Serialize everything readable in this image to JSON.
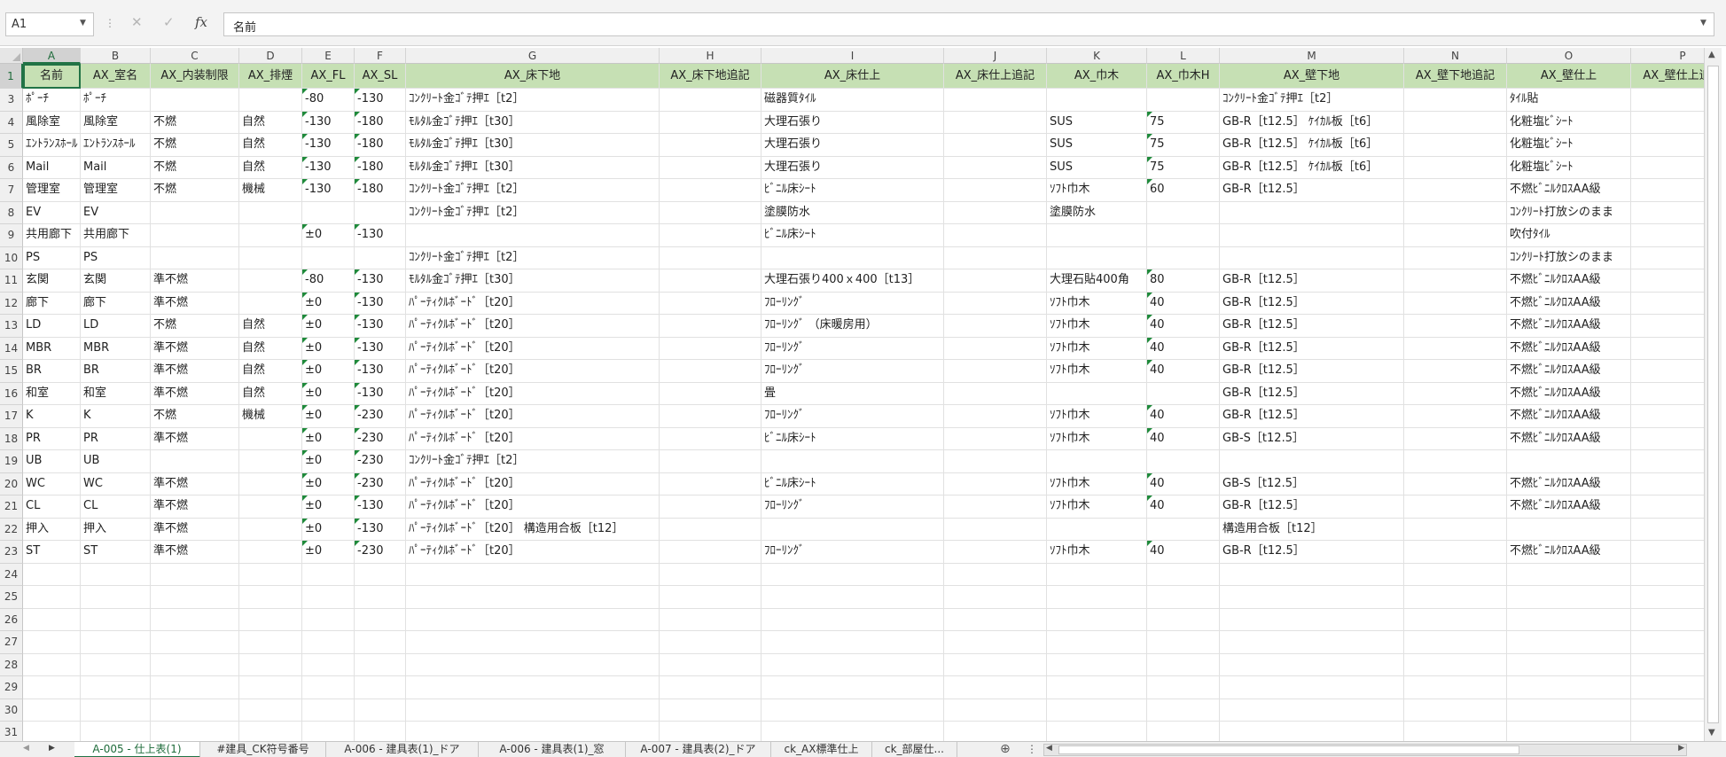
{
  "formula_bar": {
    "name_box": "A1",
    "formula": "名前",
    "fx_label": "fx",
    "cancel_glyph": "✕",
    "enter_glyph": "✓"
  },
  "columns": [
    "A",
    "B",
    "C",
    "D",
    "E",
    "F",
    "G",
    "H",
    "I",
    "J",
    "K",
    "L",
    "M",
    "N",
    "O",
    "P"
  ],
  "selected_column": "A",
  "selected_row": "1",
  "headers": [
    "名前",
    "AX_室名",
    "AX_内装制限",
    "AX_排煙",
    "AX_FL",
    "AX_SL",
    "AX_床下地",
    "AX_床下地追記",
    "AX_床仕上",
    "AX_床仕上追記",
    "AX_巾木",
    "AX_巾木H",
    "AX_壁下地",
    "AX_壁下地追記",
    "AX_壁仕上",
    "AX_壁仕上追記"
  ],
  "rows": [
    {
      "num": "1",
      "header": true
    },
    {
      "num": "3",
      "cells": [
        "ﾎﾟｰﾁ",
        "ﾎﾟｰﾁ",
        "",
        "",
        "-80",
        "-130",
        "ｺﾝｸﾘｰﾄ金ｺﾞﾃ押ｴ［t2］",
        "",
        "磁器質ﾀｲﾙ",
        "",
        "",
        "",
        "ｺﾝｸﾘｰﾄ金ｺﾞﾃ押ｴ［t2］",
        "",
        "ﾀｲﾙ貼",
        ""
      ]
    },
    {
      "num": "4",
      "cells": [
        "風除室",
        "風除室",
        "不燃",
        "自然",
        "-130",
        "-180",
        "ﾓﾙﾀﾙ金ｺﾞﾃ押ｴ［t30］",
        "",
        "大理石張り",
        "",
        "SUS",
        "75",
        "GB-R［t12.5］ ｹｲｶﾙ板［t6］",
        "",
        "化粧塩ﾋﾞｼｰﾄ",
        ""
      ]
    },
    {
      "num": "5",
      "cells": [
        "ｴﾝﾄﾗﾝｽﾎｰﾙ",
        "ｴﾝﾄﾗﾝｽﾎｰﾙ",
        "不燃",
        "自然",
        "-130",
        "-180",
        "ﾓﾙﾀﾙ金ｺﾞﾃ押ｴ［t30］",
        "",
        "大理石張り",
        "",
        "SUS",
        "75",
        "GB-R［t12.5］ ｹｲｶﾙ板［t6］",
        "",
        "化粧塩ﾋﾞｼｰﾄ",
        ""
      ]
    },
    {
      "num": "6",
      "cells": [
        "Mail",
        "Mail",
        "不燃",
        "自然",
        "-130",
        "-180",
        "ﾓﾙﾀﾙ金ｺﾞﾃ押ｴ［t30］",
        "",
        "大理石張り",
        "",
        "SUS",
        "75",
        "GB-R［t12.5］ ｹｲｶﾙ板［t6］",
        "",
        "化粧塩ﾋﾞｼｰﾄ",
        ""
      ]
    },
    {
      "num": "7",
      "cells": [
        "管理室",
        "管理室",
        "不燃",
        "機械",
        "-130",
        "-180",
        "ｺﾝｸﾘｰﾄ金ｺﾞﾃ押ｴ［t2］",
        "",
        "ﾋﾞﾆﾙ床ｼｰﾄ",
        "",
        "ｿﾌﾄ巾木",
        "60",
        "GB-R［t12.5］",
        "",
        "不燃ﾋﾞﾆﾙｸﾛｽAA級",
        ""
      ]
    },
    {
      "num": "8",
      "cells": [
        "EV",
        "EV",
        "",
        "",
        "",
        "",
        "ｺﾝｸﾘｰﾄ金ｺﾞﾃ押ｴ［t2］",
        "",
        "塗膜防水",
        "",
        "塗膜防水",
        "",
        "",
        "",
        "ｺﾝｸﾘｰﾄ打放シのまま",
        ""
      ]
    },
    {
      "num": "9",
      "cells": [
        "共用廊下",
        "共用廊下",
        "",
        "",
        "±0",
        "-130",
        "",
        "",
        "ﾋﾞﾆﾙ床ｼｰﾄ",
        "",
        "",
        "",
        "",
        "",
        "吹付ﾀｲﾙ",
        ""
      ]
    },
    {
      "num": "10",
      "cells": [
        "PS",
        "PS",
        "",
        "",
        "",
        "",
        "ｺﾝｸﾘｰﾄ金ｺﾞﾃ押ｴ［t2］",
        "",
        "",
        "",
        "",
        "",
        "",
        "",
        "ｺﾝｸﾘｰﾄ打放シのまま",
        ""
      ]
    },
    {
      "num": "11",
      "cells": [
        "玄関",
        "玄関",
        "準不燃",
        "",
        "-80",
        "-130",
        "ﾓﾙﾀﾙ金ｺﾞﾃ押ｴ［t30］",
        "",
        "大理石張り400ｘ400［t13］",
        "",
        "大理石貼400角",
        "80",
        "GB-R［t12.5］",
        "",
        "不燃ﾋﾞﾆﾙｸﾛｽAA級",
        ""
      ]
    },
    {
      "num": "12",
      "cells": [
        "廊下",
        "廊下",
        "準不燃",
        "",
        "±0",
        "-130",
        "ﾊﾟｰﾃｨｸﾙﾎﾞｰﾄﾞ［t20］",
        "",
        "ﾌﾛｰﾘﾝｸﾞ",
        "",
        "ｿﾌﾄ巾木",
        "40",
        "GB-R［t12.5］",
        "",
        "不燃ﾋﾞﾆﾙｸﾛｽAA級",
        ""
      ]
    },
    {
      "num": "13",
      "cells": [
        "LD",
        "LD",
        "不燃",
        "自然",
        "±0",
        "-130",
        "ﾊﾟｰﾃｨｸﾙﾎﾞｰﾄﾞ［t20］",
        "",
        "ﾌﾛｰﾘﾝｸﾞ （床暖房用）",
        "",
        "ｿﾌﾄ巾木",
        "40",
        "GB-R［t12.5］",
        "",
        "不燃ﾋﾞﾆﾙｸﾛｽAA級",
        ""
      ]
    },
    {
      "num": "14",
      "cells": [
        "MBR",
        "MBR",
        "準不燃",
        "自然",
        "±0",
        "-130",
        "ﾊﾟｰﾃｨｸﾙﾎﾞｰﾄﾞ［t20］",
        "",
        "ﾌﾛｰﾘﾝｸﾞ",
        "",
        "ｿﾌﾄ巾木",
        "40",
        "GB-R［t12.5］",
        "",
        "不燃ﾋﾞﾆﾙｸﾛｽAA級",
        ""
      ]
    },
    {
      "num": "15",
      "cells": [
        "BR",
        "BR",
        "準不燃",
        "自然",
        "±0",
        "-130",
        "ﾊﾟｰﾃｨｸﾙﾎﾞｰﾄﾞ［t20］",
        "",
        "ﾌﾛｰﾘﾝｸﾞ",
        "",
        "ｿﾌﾄ巾木",
        "40",
        "GB-R［t12.5］",
        "",
        "不燃ﾋﾞﾆﾙｸﾛｽAA級",
        ""
      ]
    },
    {
      "num": "16",
      "cells": [
        "和室",
        "和室",
        "準不燃",
        "自然",
        "±0",
        "-130",
        "ﾊﾟｰﾃｨｸﾙﾎﾞｰﾄﾞ［t20］",
        "",
        "畳",
        "",
        "",
        "",
        "GB-R［t12.5］",
        "",
        "不燃ﾋﾞﾆﾙｸﾛｽAA級",
        ""
      ]
    },
    {
      "num": "17",
      "cells": [
        "K",
        "K",
        "不燃",
        "機械",
        "±0",
        "-230",
        "ﾊﾟｰﾃｨｸﾙﾎﾞｰﾄﾞ［t20］",
        "",
        "ﾌﾛｰﾘﾝｸﾞ",
        "",
        "ｿﾌﾄ巾木",
        "40",
        "GB-R［t12.5］",
        "",
        "不燃ﾋﾞﾆﾙｸﾛｽAA級",
        ""
      ]
    },
    {
      "num": "18",
      "cells": [
        "PR",
        "PR",
        "準不燃",
        "",
        "±0",
        "-230",
        "ﾊﾟｰﾃｨｸﾙﾎﾞｰﾄﾞ［t20］",
        "",
        "ﾋﾞﾆﾙ床ｼｰﾄ",
        "",
        "ｿﾌﾄ巾木",
        "40",
        "GB-S［t12.5］",
        "",
        "不燃ﾋﾞﾆﾙｸﾛｽAA級",
        ""
      ]
    },
    {
      "num": "19",
      "cells": [
        "UB",
        "UB",
        "",
        "",
        "±0",
        "-230",
        "ｺﾝｸﾘｰﾄ金ｺﾞﾃ押ｴ［t2］",
        "",
        "",
        "",
        "",
        "",
        "",
        "",
        "",
        ""
      ]
    },
    {
      "num": "20",
      "cells": [
        "WC",
        "WC",
        "準不燃",
        "",
        "±0",
        "-230",
        "ﾊﾟｰﾃｨｸﾙﾎﾞｰﾄﾞ［t20］",
        "",
        "ﾋﾞﾆﾙ床ｼｰﾄ",
        "",
        "ｿﾌﾄ巾木",
        "40",
        "GB-S［t12.5］",
        "",
        "不燃ﾋﾞﾆﾙｸﾛｽAA級",
        ""
      ]
    },
    {
      "num": "21",
      "cells": [
        "CL",
        "CL",
        "準不燃",
        "",
        "±0",
        "-130",
        "ﾊﾟｰﾃｨｸﾙﾎﾞｰﾄﾞ［t20］",
        "",
        "ﾌﾛｰﾘﾝｸﾞ",
        "",
        "ｿﾌﾄ巾木",
        "40",
        "GB-R［t12.5］",
        "",
        "不燃ﾋﾞﾆﾙｸﾛｽAA級",
        ""
      ]
    },
    {
      "num": "22",
      "cells": [
        "押入",
        "押入",
        "準不燃",
        "",
        "±0",
        "-130",
        "ﾊﾟｰﾃｨｸﾙﾎﾞｰﾄﾞ［t20］ 構造用合板［t12］",
        "",
        "",
        "",
        "",
        "",
        "構造用合板［t12］",
        "",
        "",
        ""
      ]
    },
    {
      "num": "23",
      "cells": [
        "ST",
        "ST",
        "準不燃",
        "",
        "±0",
        "-230",
        "ﾊﾟｰﾃｨｸﾙﾎﾞｰﾄﾞ［t20］",
        "",
        "ﾌﾛｰﾘﾝｸﾞ",
        "",
        "ｿﾌﾄ巾木",
        "40",
        "GB-R［t12.5］",
        "",
        "不燃ﾋﾞﾆﾙｸﾛｽAA級",
        ""
      ]
    },
    {
      "num": "24",
      "cells": []
    },
    {
      "num": "25",
      "cells": []
    },
    {
      "num": "26",
      "cells": []
    },
    {
      "num": "27",
      "cells": []
    },
    {
      "num": "28",
      "cells": []
    },
    {
      "num": "29",
      "cells": []
    },
    {
      "num": "30",
      "cells": []
    },
    {
      "num": "31",
      "cells": []
    }
  ],
  "tabs": [
    {
      "label": "A-005 - 仕上表(1)",
      "active": true
    },
    {
      "label": "#建具_CK符号番号",
      "active": false
    },
    {
      "label": "A-006 - 建具表(1)_ドア",
      "active": false
    },
    {
      "label": "A-006 - 建具表(1)_窓",
      "active": false
    },
    {
      "label": "A-007 - 建具表(2)_ドア",
      "active": false
    },
    {
      "label": "ck_AX標準仕上",
      "active": false
    },
    {
      "label": "ck_部屋仕...",
      "active": false
    }
  ],
  "tab_bar": {
    "prev_glyph": "◀",
    "next_glyph": "▶",
    "add_glyph": "⊕",
    "more_glyph": "⋮"
  },
  "colors": {
    "header_fill": "#c6e0b4",
    "selection": "#217346",
    "error_marker": "#1f8a3b"
  }
}
